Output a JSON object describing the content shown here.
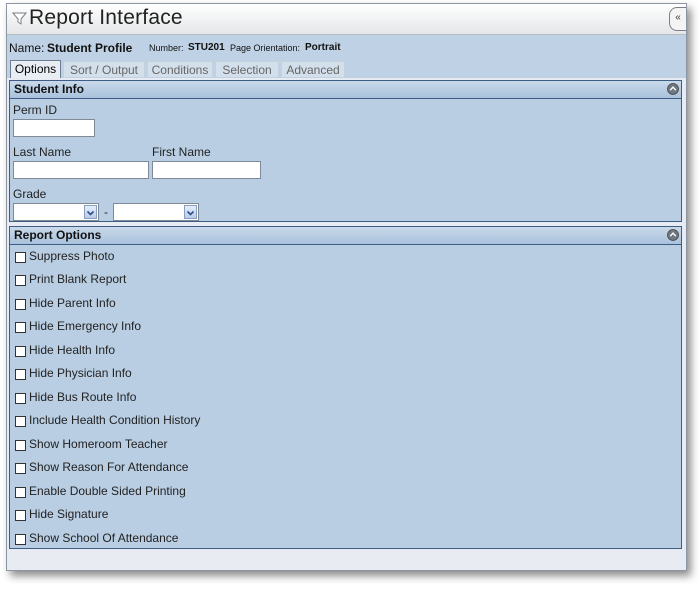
{
  "window": {
    "title": "Report Interface",
    "collapse_label": "«"
  },
  "info": {
    "name_label": "Name:",
    "name_value": "Student Profile",
    "number_label": "Number:",
    "number_value": "STU201",
    "orientation_label": "Page Orientation:",
    "orientation_value": "Portrait"
  },
  "tabs": [
    {
      "label": "Options",
      "active": true
    },
    {
      "label": "Sort / Output",
      "active": false
    },
    {
      "label": "Conditions",
      "active": false
    },
    {
      "label": "Selection",
      "active": false
    },
    {
      "label": "Advanced",
      "active": false
    }
  ],
  "student_info": {
    "title": "Student Info",
    "perm_id_label": "Perm ID",
    "perm_id_value": "",
    "last_name_label": "Last Name",
    "last_name_value": "",
    "first_name_label": "First Name",
    "first_name_value": "",
    "grade_label": "Grade",
    "grade_from": "",
    "grade_to": "",
    "grade_separator": "-"
  },
  "report_options": {
    "title": "Report Options",
    "items": [
      {
        "label": "Suppress Photo",
        "checked": false
      },
      {
        "label": "Print Blank Report",
        "checked": false
      },
      {
        "label": "Hide Parent Info",
        "checked": false
      },
      {
        "label": "Hide Emergency Info",
        "checked": false
      },
      {
        "label": "Hide Health Info",
        "checked": false
      },
      {
        "label": "Hide Physician Info",
        "checked": false
      },
      {
        "label": "Hide Bus Route Info",
        "checked": false
      },
      {
        "label": "Include Health Condition History",
        "checked": false
      },
      {
        "label": "Show Homeroom Teacher",
        "checked": false
      },
      {
        "label": "Show Reason For Attendance",
        "checked": false
      },
      {
        "label": "Enable Double Sided Printing",
        "checked": false
      },
      {
        "label": "Hide Signature",
        "checked": false
      },
      {
        "label": "Show School Of Attendance",
        "checked": false
      }
    ]
  },
  "colors": {
    "panel_bg": "#b9cee3",
    "panel_border": "#3d5d85",
    "infobar_bg": "#bfd2e5"
  }
}
